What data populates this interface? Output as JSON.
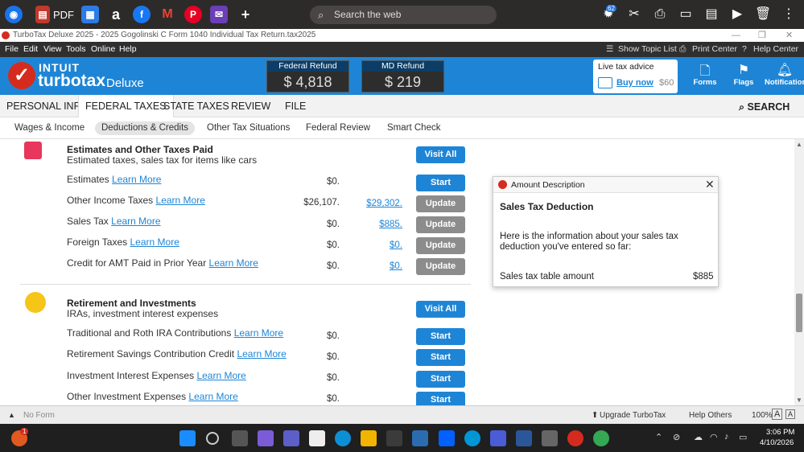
{
  "browser": {
    "pdf_label": "PDF",
    "search_placeholder": "Search the web",
    "badge_count": "62"
  },
  "window": {
    "title": "TurboTax Deluxe 2025 - 2025 Gogolinski C Form 1040  Individual Tax Return.tax2025"
  },
  "menu": {
    "items": [
      "File",
      "Edit",
      "View",
      "Tools",
      "Online",
      "Help"
    ],
    "show_topic_list": "Show Topic List",
    "print_center": "Print Center",
    "help_center": "Help Center"
  },
  "header": {
    "brand_intuit": "INTUIT",
    "brand_turbotax": "turbotax",
    "brand_edition": "Deluxe",
    "federal_label": "Federal Refund",
    "federal_amount": "$ 4,818",
    "md_label": "MD Refund",
    "md_amount": "$ 219",
    "live_title": "Live tax advice",
    "buy_now": "Buy now",
    "buy_price": "$60",
    "forms": "Forms",
    "flags": "Flags",
    "notifications": "Notifications"
  },
  "main_tabs": {
    "personal": "PERSONAL INFO",
    "federal": "FEDERAL TAXES",
    "state": "STATE TAXES",
    "review": "REVIEW",
    "file": "FILE",
    "search": "SEARCH"
  },
  "sub_tabs": {
    "wages": "Wages & Income",
    "deductions": "Deductions & Credits",
    "other": "Other Tax Situations",
    "federal_review": "Federal Review",
    "smart_check": "Smart Check"
  },
  "estimates_section": {
    "title": "Estimates and Other Taxes Paid",
    "subtitle": "Estimated taxes, sales tax for items like cars",
    "visit_all": "Visit All",
    "rows": [
      {
        "label": "Estimates",
        "learn": "Learn More",
        "value": "$0.",
        "link": "",
        "button": "Start"
      },
      {
        "label": "Other Income Taxes",
        "learn": "Learn More",
        "value": "$26,107.",
        "link": "$29,302.",
        "button": "Update"
      },
      {
        "label": "Sales Tax",
        "learn": "Learn More",
        "value": "$0.",
        "link": "$885.",
        "button": "Update"
      },
      {
        "label": "Foreign Taxes",
        "learn": "Learn More",
        "value": "$0.",
        "link": "$0.",
        "button": "Update"
      },
      {
        "label": "Credit for AMT Paid in Prior Year",
        "learn": "Learn More",
        "value": "$0.",
        "link": "$0.",
        "button": "Update"
      }
    ]
  },
  "retirement_section": {
    "title": "Retirement and Investments",
    "subtitle": "IRAs, investment interest expenses",
    "visit_all": "Visit All",
    "rows": [
      {
        "label": "Traditional and Roth IRA Contributions",
        "learn": "Learn More",
        "value": "$0.",
        "button": "Start"
      },
      {
        "label": "Retirement Savings Contribution Credit",
        "learn": "Learn More",
        "value": "$0.",
        "button": "Start"
      },
      {
        "label": "Investment Interest Expenses",
        "learn": "Learn More",
        "value": "$0.",
        "button": "Start"
      },
      {
        "label": "Other Investment Expenses",
        "learn": "Learn More",
        "value": "$0.",
        "button": "Start"
      }
    ]
  },
  "popup": {
    "header": "Amount Description",
    "title": "Sales Tax Deduction",
    "text": "Here is the information about your sales tax deduction you've entered so far:",
    "row_label": "Sales tax table amount",
    "row_value": "$885"
  },
  "status_bar": {
    "no_form": "No Form",
    "upgrade": "Upgrade TurboTax",
    "help_others": "Help Others",
    "zoom": "100%"
  },
  "taskbar": {
    "time": "3:06 PM",
    "date": "4/10/2026",
    "notification_count": "1"
  },
  "colors": {
    "brand_blue": "#1e85d6",
    "brand_red": "#d52b1e",
    "update_gray": "#8c8c8c"
  }
}
